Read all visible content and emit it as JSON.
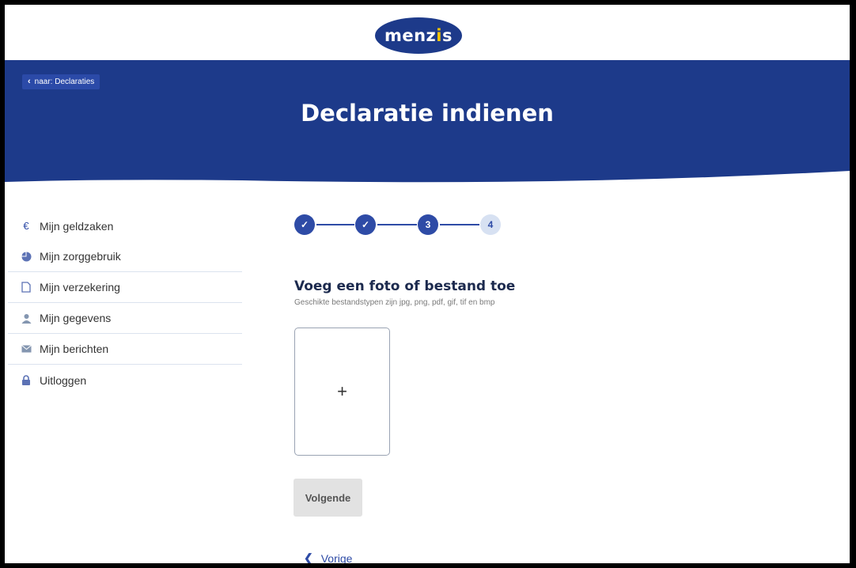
{
  "header": {
    "logo_text_a": "menz",
    "logo_text_b": "i",
    "logo_text_c": "s"
  },
  "hero": {
    "back_label": "naar: Declaraties",
    "title": "Declaratie indienen"
  },
  "sidebar": {
    "items": [
      {
        "label": "Mijn geldzaken",
        "icon": "euro-icon"
      },
      {
        "label": "Mijn zorggebruik",
        "icon": "pie-chart-icon"
      },
      {
        "label": "Mijn verzekering",
        "icon": "document-icon"
      },
      {
        "label": "Mijn gegevens",
        "icon": "user-icon"
      },
      {
        "label": "Mijn berichten",
        "icon": "envelope-icon"
      },
      {
        "label": "Uitloggen",
        "icon": "lock-icon"
      }
    ]
  },
  "stepper": {
    "steps": [
      {
        "state": "done",
        "label": "✓"
      },
      {
        "state": "done",
        "label": "✓"
      },
      {
        "state": "current",
        "label": "3"
      },
      {
        "state": "next",
        "label": "4"
      }
    ]
  },
  "upload": {
    "title": "Voeg een foto of bestand toe",
    "subtitle": "Geschikte bestandstypen zijn jpg, png, pdf, gif, tif en bmp",
    "add_symbol": "+"
  },
  "actions": {
    "next_label": "Volgende",
    "prev_label": "Vorige"
  },
  "colors": {
    "brand_blue": "#1d3a8a",
    "accent_yellow": "#f5c400",
    "sidebar_bg": "#eaf0f9"
  }
}
